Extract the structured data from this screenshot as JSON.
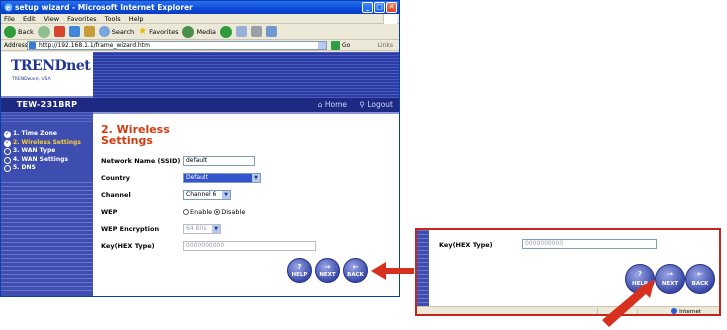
{
  "window": {
    "title": "setup wizard - Microsoft Internet Explorer",
    "controls": [
      "_",
      "□",
      "✕"
    ]
  },
  "menu": [
    "File",
    "Edit",
    "View",
    "Favorites",
    "Tools",
    "Help"
  ],
  "toolbar": {
    "back": "Back",
    "search": "Search",
    "favorites": "Favorites",
    "media": "Media"
  },
  "address": {
    "label": "Address",
    "url": "http://192.168.1.1/frame_wizard.htm",
    "go": "Go",
    "links": "Links"
  },
  "brand": {
    "logo": "TRENDnet",
    "sub": "TRENDware, USA",
    "model": "TEW-231BRP"
  },
  "header": {
    "home": "Home",
    "logout": "Logout"
  },
  "steps": [
    {
      "label": "1. Time Zone",
      "done": true
    },
    {
      "label": "2. Wireless Settings",
      "done": true
    },
    {
      "label": "3. WAN Type",
      "done": false
    },
    {
      "label": "4. WAN Settings",
      "done": false
    },
    {
      "label": "5. DNS",
      "done": false
    }
  ],
  "form": {
    "heading": "2. Wireless Settings",
    "ssid_label": "Network Name (SSID)",
    "ssid_value": "default",
    "country_label": "Country",
    "country_value": "Default",
    "channel_label": "Channel",
    "channel_value": "Channel 6",
    "wep_label": "WEP",
    "wep_enable": "Enable",
    "wep_disable": "Disable",
    "wep_selected": "Disable",
    "wep_enc_label": "WEP Encryption",
    "wep_enc_value": "64 Bits",
    "key_label": "Key(HEX Type)",
    "key_value": "0000000000"
  },
  "buttons": {
    "help": "HELP",
    "next": "NEXT",
    "back": "BACK"
  },
  "status": {
    "zone": "Internet"
  },
  "colors": {
    "heading": "#d23a10",
    "sidebar": "#3d4db0",
    "callout": "#c4261b"
  }
}
